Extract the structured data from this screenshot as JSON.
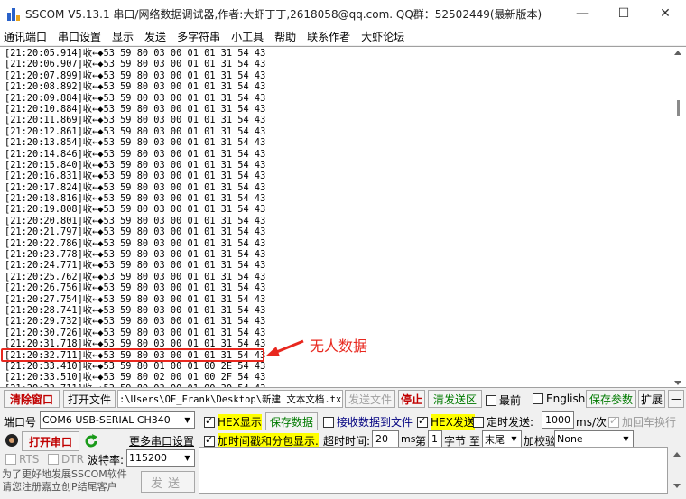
{
  "window": {
    "title": "SSCOM V5.13.1 串口/网络数据调试器,作者:大虾丁丁,2618058@qq.com. QQ群：52502449(最新版本)",
    "minimize": "—",
    "maximize": "☐",
    "close": "✕"
  },
  "menu": [
    "通讯端口",
    "串口设置",
    "显示",
    "发送",
    "多字符串",
    "小工具",
    "帮助",
    "联系作者",
    "大虾论坛"
  ],
  "receive": {
    "lines": [
      {
        "time": "21:20:05.914",
        "data": "53 59 80 03 00 01 01 31 54 43"
      },
      {
        "time": "21:20:06.907",
        "data": "53 59 80 03 00 01 01 31 54 43"
      },
      {
        "time": "21:20:07.899",
        "data": "53 59 80 03 00 01 01 31 54 43"
      },
      {
        "time": "21:20:08.892",
        "data": "53 59 80 03 00 01 01 31 54 43"
      },
      {
        "time": "21:20:09.884",
        "data": "53 59 80 03 00 01 01 31 54 43"
      },
      {
        "time": "21:20:10.884",
        "data": "53 59 80 03 00 01 01 31 54 43"
      },
      {
        "time": "21:20:11.869",
        "data": "53 59 80 03 00 01 01 31 54 43"
      },
      {
        "time": "21:20:12.861",
        "data": "53 59 80 03 00 01 01 31 54 43"
      },
      {
        "time": "21:20:13.854",
        "data": "53 59 80 03 00 01 01 31 54 43"
      },
      {
        "time": "21:20:14.846",
        "data": "53 59 80 03 00 01 01 31 54 43"
      },
      {
        "time": "21:20:15.840",
        "data": "53 59 80 03 00 01 01 31 54 43"
      },
      {
        "time": "21:20:16.831",
        "data": "53 59 80 03 00 01 01 31 54 43"
      },
      {
        "time": "21:20:17.824",
        "data": "53 59 80 03 00 01 01 31 54 43"
      },
      {
        "time": "21:20:18.816",
        "data": "53 59 80 03 00 01 01 31 54 43"
      },
      {
        "time": "21:20:19.808",
        "data": "53 59 80 03 00 01 01 31 54 43"
      },
      {
        "time": "21:20:20.801",
        "data": "53 59 80 03 00 01 01 31 54 43"
      },
      {
        "time": "21:20:21.797",
        "data": "53 59 80 03 00 01 01 31 54 43"
      },
      {
        "time": "21:20:22.786",
        "data": "53 59 80 03 00 01 01 31 54 43"
      },
      {
        "time": "21:20:23.778",
        "data": "53 59 80 03 00 01 01 31 54 43"
      },
      {
        "time": "21:20:24.771",
        "data": "53 59 80 03 00 01 01 31 54 43"
      },
      {
        "time": "21:20:25.762",
        "data": "53 59 80 03 00 01 01 31 54 43"
      },
      {
        "time": "21:20:26.756",
        "data": "53 59 80 03 00 01 01 31 54 43"
      },
      {
        "time": "21:20:27.754",
        "data": "53 59 80 03 00 01 01 31 54 43"
      },
      {
        "time": "21:20:28.741",
        "data": "53 59 80 03 00 01 01 31 54 43"
      },
      {
        "time": "21:20:29.732",
        "data": "53 59 80 03 00 01 01 31 54 43"
      },
      {
        "time": "21:20:30.726",
        "data": "53 59 80 03 00 01 01 31 54 43"
      },
      {
        "time": "21:20:31.718",
        "data": "53 59 80 03 00 01 01 31 54 43"
      },
      {
        "time": "21:20:32.711",
        "data": "53 59 80 03 00 01 01 31 54 43"
      },
      {
        "time": "21:20:33.410",
        "data": "53 59 80 01 00 01 00 2E 54 43"
      },
      {
        "time": "21:20:33.510",
        "data": "53 59 80 02 00 01 00 2F 54 43"
      },
      {
        "time": "21:20:33.711",
        "data": "53 59 80 03 00 01 00 30 54 43"
      }
    ],
    "direction": "收←◆",
    "annotation": "无人数据"
  },
  "toolbar": {
    "clear": "清除窗口",
    "open_file": "打开文件",
    "file_path": ":\\Users\\OF_Frank\\Desktop\\新建 文本文档.txt",
    "send_file": "发送文件",
    "stop": "停止",
    "clear_send": "清发送区",
    "topmost": "最前",
    "english": "English",
    "save_params": "保存参数",
    "expand": "扩展",
    "dash": "—"
  },
  "panel": {
    "port_label": "端口号",
    "port_value": "COM6 USB-SERIAL CH340",
    "open_port": "打开串口",
    "more_settings": "更多串口设置",
    "rts": "RTS",
    "dtr": "DTR",
    "baud_label": "波特率:",
    "baud_value": "115200",
    "hex_display": "HEX显示",
    "save_data": "保存数据",
    "recv_to_file": "接收数据到文件",
    "hex_send": "HEX发送",
    "timed_send": "定时发送:",
    "interval": "1000",
    "interval_unit": "ms/次",
    "add_crlf": "加回车换行",
    "timestamp": "加时间戳和分包显示.",
    "timeout_label": "超时时间:",
    "timeout": "20",
    "ms": "ms",
    "nth": "第",
    "byte_index": "1",
    "byte_to": "字节 至",
    "tail": "末尾",
    "checksum_label": "加校验",
    "checksum": "None",
    "promo_line1": "为了更好地发展SSCOM软件",
    "promo_line2": "请您注册嘉立创P结尾客户",
    "send": "发送"
  }
}
